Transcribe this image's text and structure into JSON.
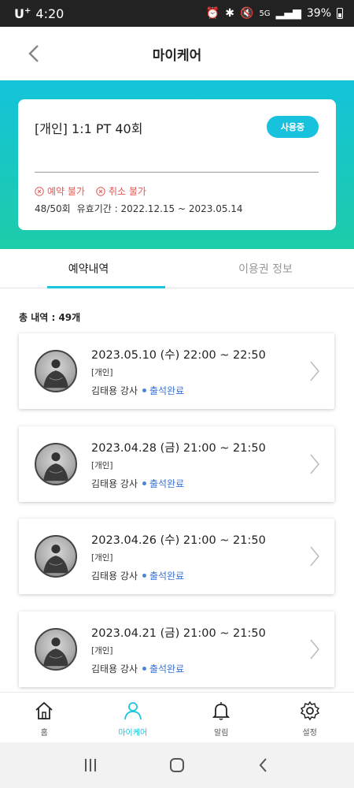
{
  "status_bar": {
    "carrier": "U",
    "carrier_sup": "+",
    "time": "4:20",
    "battery": "39%",
    "net": "5G"
  },
  "header": {
    "title": "마이케어"
  },
  "pass": {
    "name": "[개인] 1:1 PT 40회",
    "status": "사용중",
    "flags": [
      "예약 불가",
      "취소 불가"
    ],
    "count": "48/50회",
    "validity": "유효기간 : 2022.12.15 ~ 2023.05.14"
  },
  "tabs": [
    {
      "label": "예약내역",
      "active": true
    },
    {
      "label": "이용권 정보",
      "active": false
    }
  ],
  "total": "총 내역 : 49개",
  "bookings": [
    {
      "datetime": "2023.05.10 (수) 22:00 ~ 22:50",
      "type": "[개인]",
      "trainer": "김태용 강사",
      "status": "출석완료"
    },
    {
      "datetime": "2023.04.28 (금) 21:00 ~ 21:50",
      "type": "[개인]",
      "trainer": "김태용 강사",
      "status": "출석완료"
    },
    {
      "datetime": "2023.04.26 (수) 21:00 ~ 21:50",
      "type": "[개인]",
      "trainer": "김태용 강사",
      "status": "출석완료"
    },
    {
      "datetime": "2023.04.21 (금) 21:00 ~ 21:50",
      "type": "[개인]",
      "trainer": "김태용 강사",
      "status": "출석완료"
    }
  ],
  "nav": [
    {
      "label": "홈",
      "icon": "home-icon"
    },
    {
      "label": "마이케어",
      "icon": "person-icon",
      "active": true
    },
    {
      "label": "알림",
      "icon": "bell-icon"
    },
    {
      "label": "설정",
      "icon": "gear-icon"
    }
  ],
  "colors": {
    "accent": "#1ac6dc",
    "danger": "#e25a55",
    "status_blue": "#3a73d4"
  }
}
